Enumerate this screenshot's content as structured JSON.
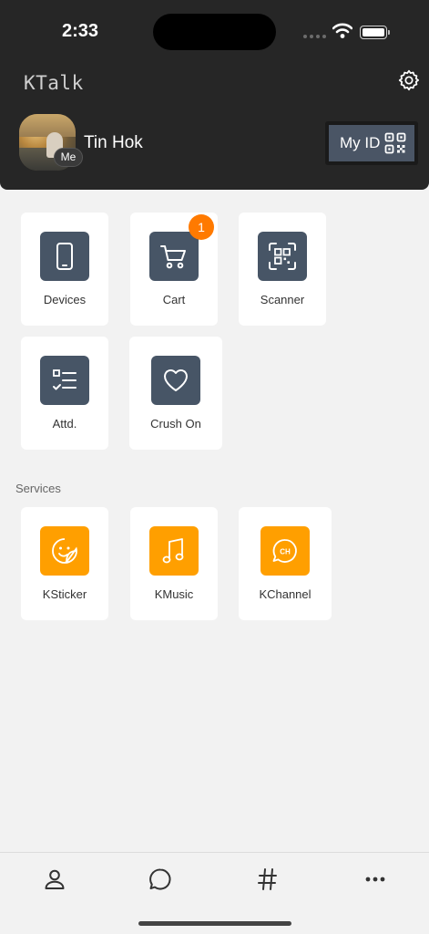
{
  "status_bar": {
    "time": "2:33"
  },
  "header": {
    "app_title": "KTalk",
    "user_name": "Tin Hok",
    "me_badge": "Me",
    "my_id_label": "My ID"
  },
  "tiles": [
    {
      "label": "Devices",
      "icon": "phone-icon"
    },
    {
      "label": "Cart",
      "icon": "cart-icon",
      "badge": "1"
    },
    {
      "label": "Scanner",
      "icon": "qr-scan-icon"
    },
    {
      "label": "Attd.",
      "icon": "checklist-icon"
    },
    {
      "label": "Crush On",
      "icon": "heart-icon"
    }
  ],
  "services": {
    "title": "Services",
    "items": [
      {
        "label": "KSticker",
        "icon": "sticker-icon"
      },
      {
        "label": "KMusic",
        "icon": "music-note-icon"
      },
      {
        "label": "KChannel",
        "icon": "channel-chat-icon",
        "icon_text": "CH"
      }
    ]
  },
  "bottom_nav": [
    {
      "name": "profile",
      "icon": "person-icon"
    },
    {
      "name": "chats",
      "icon": "chat-bubble-icon"
    },
    {
      "name": "channels",
      "icon": "hashtag-icon"
    },
    {
      "name": "more",
      "icon": "more-dots-icon"
    }
  ],
  "colors": {
    "header_bg": "#262626",
    "tile_icon_dark": "#475566",
    "service_icon": "#ff9f00",
    "badge": "#ff7a00"
  }
}
